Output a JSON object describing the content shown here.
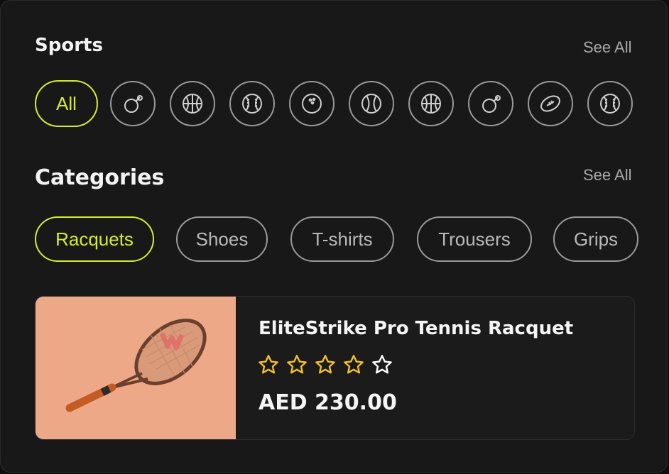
{
  "sports": {
    "title": "Sports",
    "see_all": "See All",
    "all_label": "All",
    "icons": [
      "table-tennis-icon",
      "basketball-icon",
      "baseball-icon",
      "bowling-ball-icon",
      "tennis-ball-icon",
      "basketball-icon",
      "table-tennis-icon",
      "american-football-icon",
      "baseball-icon"
    ]
  },
  "categories": {
    "title": "Categories",
    "see_all": "See All",
    "items": [
      "Racquets",
      "Shoes",
      "T-shirts",
      "Trousers",
      "Grips"
    ],
    "active_index": 0
  },
  "product": {
    "name": "EliteStrike Pro Tennis Racquet",
    "price": "AED 230.00",
    "rating": 4,
    "rating_max": 5,
    "image_icon": "tennis-racquet-icon"
  },
  "colors": {
    "accent": "#d4ee2c",
    "star": "#f4c02a",
    "card_bg": "#181818",
    "image_bg": "#eda987"
  }
}
